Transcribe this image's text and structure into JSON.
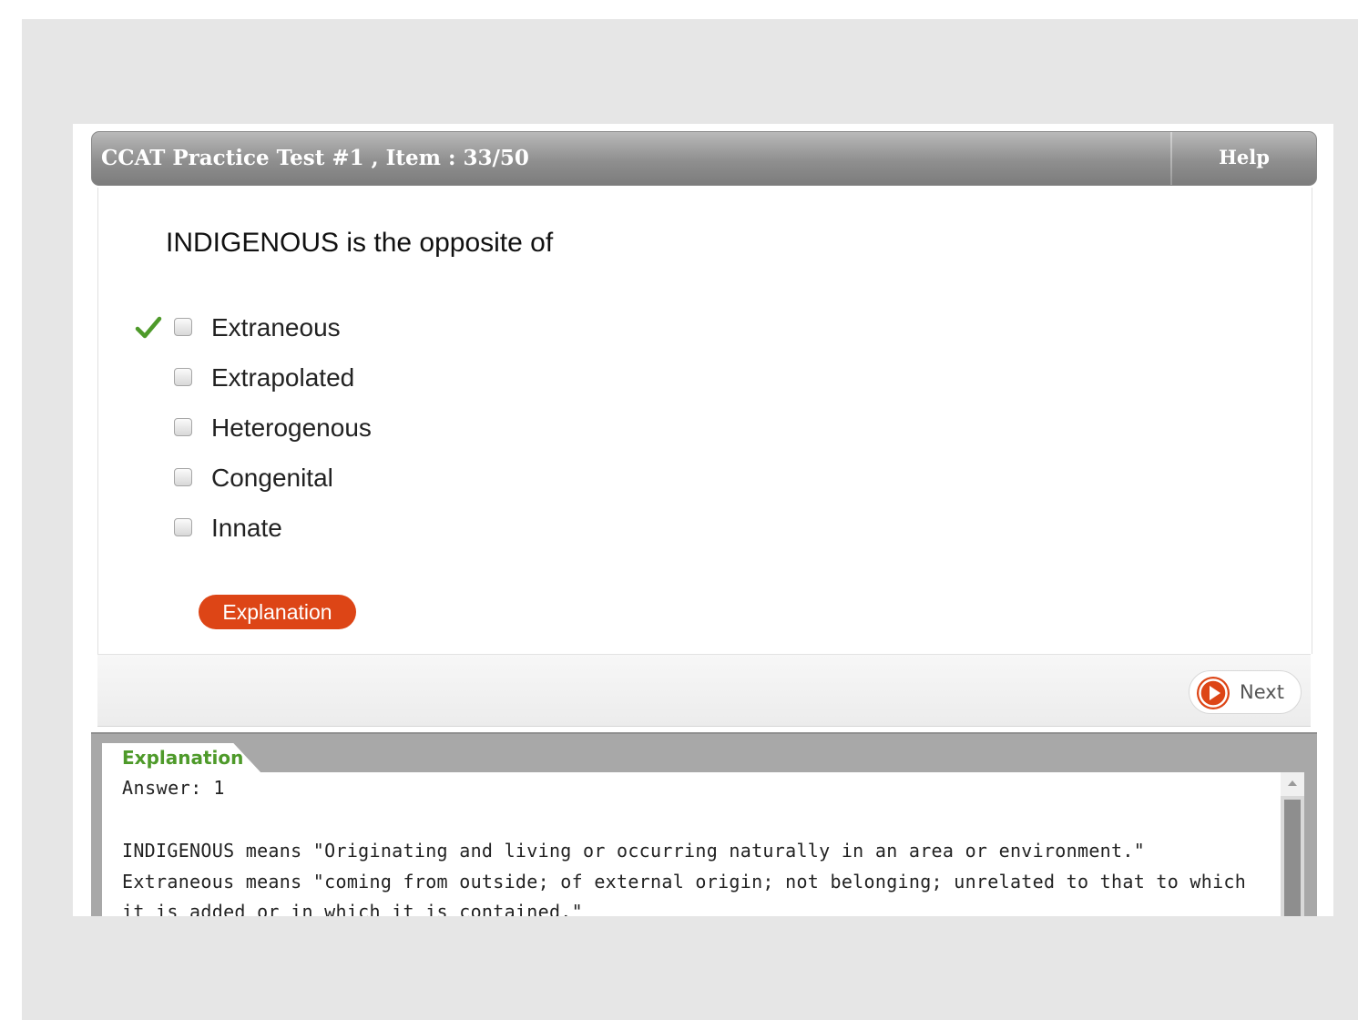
{
  "header": {
    "title": "CCAT Practice Test #1 , Item : 33/50",
    "help_label": "Help"
  },
  "question": {
    "prompt": "INDIGENOUS is the opposite of",
    "options": [
      {
        "label": "Extraneous",
        "checked": false,
        "correct_marker": true
      },
      {
        "label": "Extrapolated",
        "checked": false,
        "correct_marker": false
      },
      {
        "label": "Heterogenous",
        "checked": false,
        "correct_marker": false
      },
      {
        "label": "Congenital",
        "checked": false,
        "correct_marker": false
      },
      {
        "label": "Innate",
        "checked": false,
        "correct_marker": false
      }
    ],
    "explanation_button_label": "Explanation"
  },
  "navigation": {
    "next_label": "Next"
  },
  "explanation": {
    "tab_label": "Explanation",
    "answer": "Answer: 1",
    "body": "INDIGENOUS means \"Originating and living or occurring naturally in an area or environment.\"\nExtraneous means \"coming from outside; of external origin; not belonging; unrelated to that to which it is added or in which it is contained.\""
  },
  "colors": {
    "explanation_button": "#dd4516",
    "check_mark": "#4e9a2a",
    "next_icon": "#dd4516",
    "title_bar": "#8f8f8f"
  },
  "icons": {
    "correct_marker": "check-icon",
    "next": "play-circle-icon"
  }
}
